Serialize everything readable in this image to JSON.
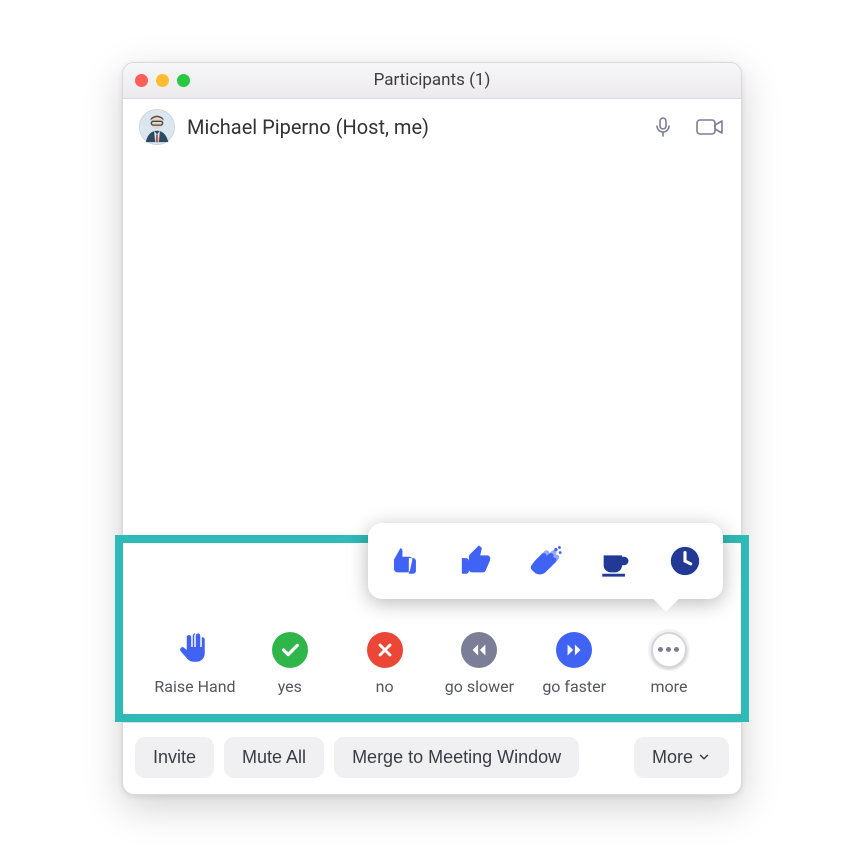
{
  "window": {
    "title": "Participants (1)"
  },
  "participants": [
    {
      "name": "Michael Piperno (Host, me)",
      "mic_muted": false,
      "video_on": true
    }
  ],
  "reactions": {
    "raise_hand": "Raise Hand",
    "yes": "yes",
    "no": "no",
    "go_slower": "go slower",
    "go_faster": "go faster",
    "more": "more",
    "popup": {
      "thumbs_down": "thumbs-down",
      "thumbs_up": "thumbs-up",
      "clap": "clap",
      "coffee": "coffee-break",
      "clock": "away"
    }
  },
  "footer": {
    "invite": "Invite",
    "mute_all": "Mute All",
    "merge": "Merge to Meeting Window",
    "more": "More"
  },
  "colors": {
    "highlight_border": "#2fbab7",
    "reaction_blue": "#4063f6",
    "reaction_green": "#2fb64a",
    "reaction_red": "#ec4637",
    "reaction_gray": "#7c7d96"
  }
}
